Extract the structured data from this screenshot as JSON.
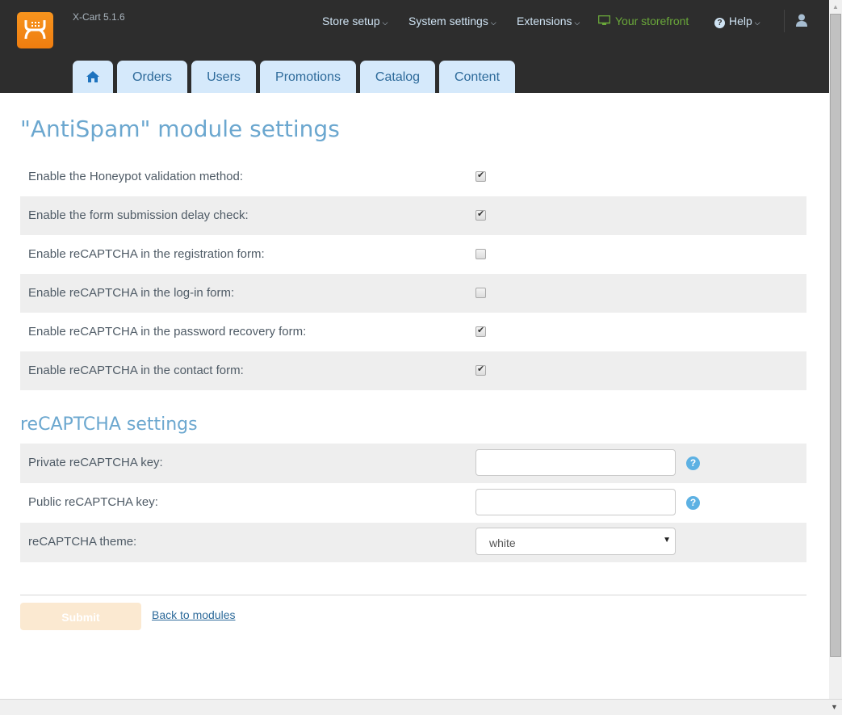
{
  "app": {
    "version": "X-Cart 5.1.6"
  },
  "topnav": {
    "store_setup": "Store setup",
    "system_settings": "System settings",
    "extensions": "Extensions",
    "storefront": "Your storefront",
    "help": "Help",
    "storefront_color": "#6aa83a"
  },
  "tabs": [
    "Orders",
    "Users",
    "Promotions",
    "Catalog",
    "Content"
  ],
  "page": {
    "title": "\"AntiSpam\" module settings",
    "settings": [
      {
        "label": "Enable the Honeypot validation method:",
        "checked": true
      },
      {
        "label": "Enable the form submission delay check:",
        "checked": true
      },
      {
        "label": "Enable reCAPTCHA in the registration form:",
        "checked": false
      },
      {
        "label": "Enable reCAPTCHA in the log-in form:",
        "checked": false
      },
      {
        "label": "Enable reCAPTCHA in the password recovery form:",
        "checked": true
      },
      {
        "label": "Enable reCAPTCHA in the contact form:",
        "checked": true
      }
    ],
    "recaptcha_title": "reCAPTCHA settings",
    "private_key_label": "Private reCAPTCHA key:",
    "private_key_value": "",
    "public_key_label": "Public reCAPTCHA key:",
    "public_key_value": "",
    "theme_label": "reCAPTCHA theme:",
    "theme_value": "white",
    "submit": "Submit",
    "back": "Back to modules"
  },
  "icons": {
    "help": "?",
    "check": "✔",
    "dropdown": "▼"
  }
}
